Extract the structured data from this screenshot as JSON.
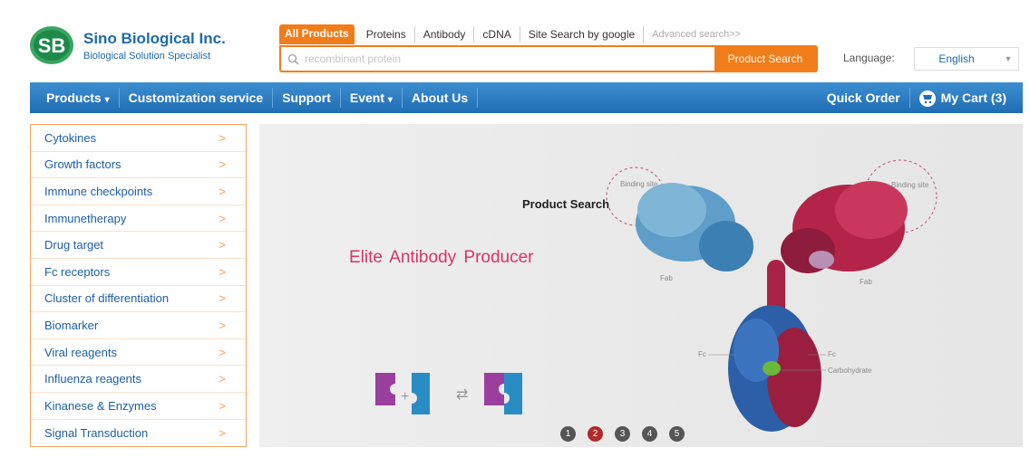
{
  "brand": {
    "name": "Sino Biological Inc.",
    "tagline": "Biological Solution Specialist",
    "logo_letters": "SB"
  },
  "search": {
    "tabs": [
      {
        "label": "All Products",
        "active": true
      },
      {
        "label": "Proteins"
      },
      {
        "label": "Antibody"
      },
      {
        "label": "cDNA"
      },
      {
        "label": "Site Search by google"
      }
    ],
    "advanced_label": "Advanced search>>",
    "placeholder": "recombinant protein",
    "button_label": "Product Search"
  },
  "language": {
    "label": "Language:",
    "selected": "English"
  },
  "nav": {
    "items": [
      "Products",
      "Customization service",
      "Support",
      "Event",
      "About Us"
    ],
    "quick_order": "Quick Order",
    "cart_label": "My Cart (3)"
  },
  "categories": [
    "Cytokines",
    "Growth factors",
    "Immune checkpoints",
    "Immunetherapy",
    "Drug target",
    "Fc receptors",
    "Cluster of differentiation",
    "Biomarker",
    "Viral reagents",
    "Influenza reagents",
    "Kinanese & Enzymes",
    "Signal Transduction"
  ],
  "banner": {
    "title": "Elite  Antibody  Producer",
    "overlay_label": "Product Search",
    "annotations": {
      "binding_site_left": "Binding site",
      "binding_site_right": "Binding site",
      "fab_left": "Fab",
      "fab_right": "Fab",
      "fc_left": "Fc",
      "fc_right": "Fc",
      "carbohydrate": "Carbohydrate"
    },
    "slides": [
      "1",
      "2",
      "3",
      "4",
      "5"
    ],
    "active_slide": 2
  },
  "colors": {
    "accent_orange": "#f07d1a",
    "brand_blue": "#1e6aa8",
    "nav_blue": "#2a7cc4",
    "banner_pink": "#d8336b"
  }
}
